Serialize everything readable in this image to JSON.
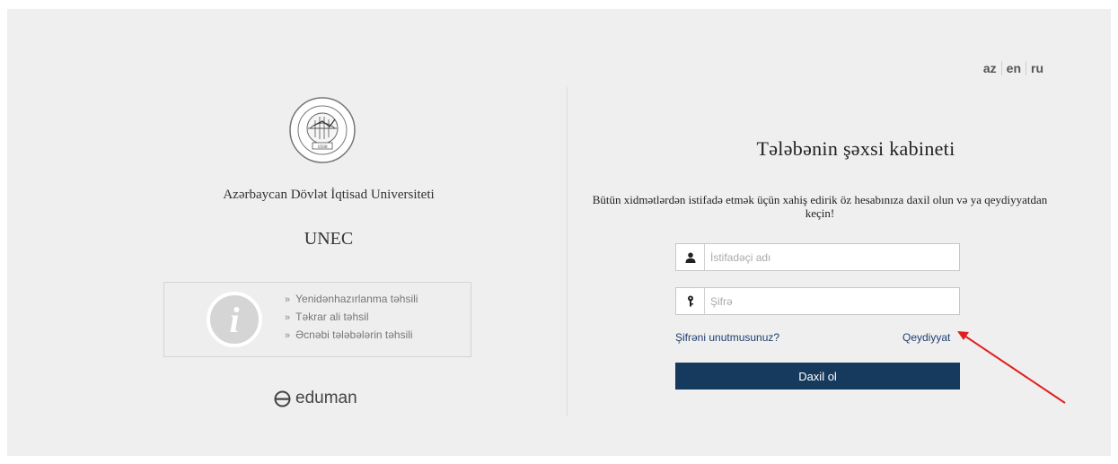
{
  "languages": [
    "az",
    "en",
    "ru"
  ],
  "left": {
    "university_name": "Azərbaycan Dövlət İqtisad Universiteti",
    "short_name": "UNEC",
    "logo_year": "1930",
    "info_links": [
      "Yenidənhazırlanma təhsili",
      "Təkrar ali təhsil",
      "Əcnəbi tələbələrin təhsili"
    ],
    "vendor": "eduman"
  },
  "login": {
    "title": "Tələbənin şəxsi kabineti",
    "subtitle": "Bütün xidmətlərdən istifadə etmək üçün xahiş edirik öz hesabınıza daxil olun və ya qeydiyyatdan keçin!",
    "username_placeholder": "İstifadəçi adı",
    "password_placeholder": "Şifrə",
    "forgot_label": "Şifrəni unutmusunuz?",
    "register_label": "Qeydiyyat",
    "submit_label": "Daxil ol"
  },
  "colors": {
    "panel_bg": "#efefef",
    "primary_button": "#163a5e",
    "link": "#1e3e6e",
    "annotation_arrow": "#e02020"
  }
}
